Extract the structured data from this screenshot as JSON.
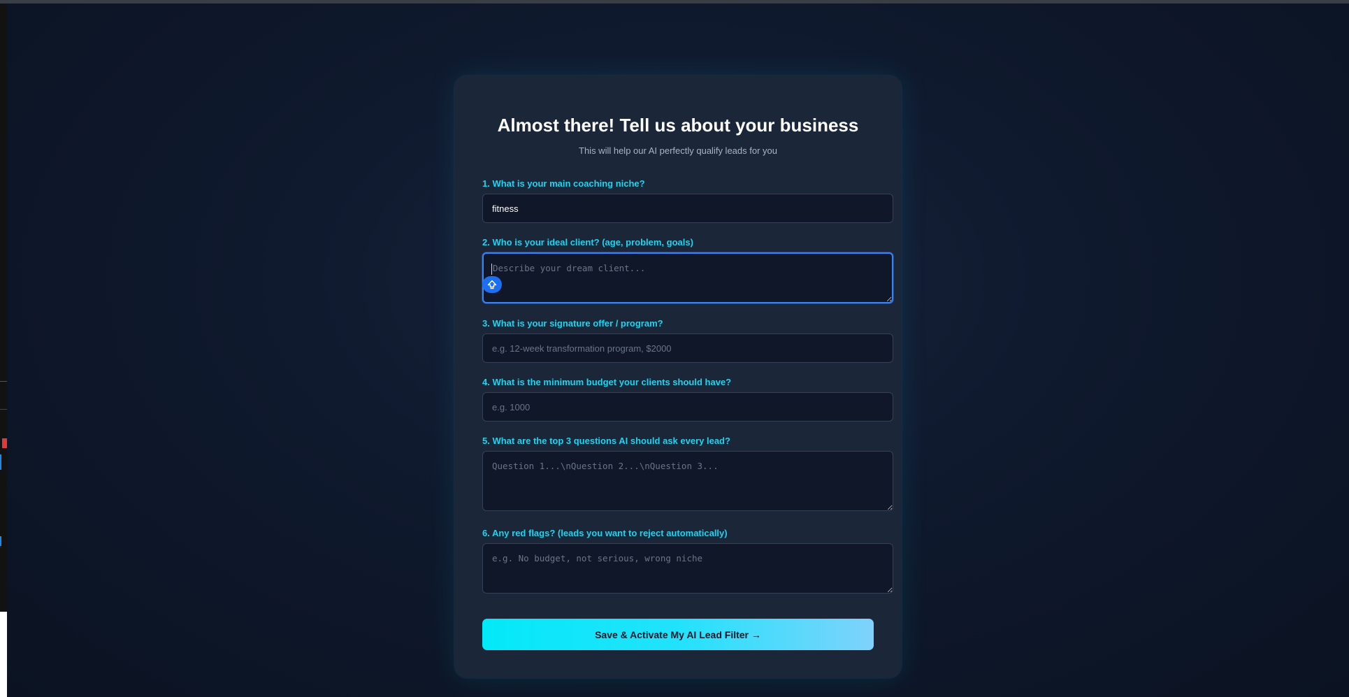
{
  "header": {
    "title": "Almost there! Tell us about your business",
    "subtitle": "This will help our AI perfectly qualify leads for you"
  },
  "form": {
    "q1": {
      "label": "1. What is your main coaching niche?",
      "value": "fitness",
      "placeholder": ""
    },
    "q2": {
      "label": "2. Who is your ideal client? (age, problem, goals)",
      "value": "",
      "placeholder": "Describe your dream client..."
    },
    "q3": {
      "label": "3. What is your signature offer / program?",
      "value": "",
      "placeholder": "e.g. 12-week transformation program, $2000"
    },
    "q4": {
      "label": "4. What is the minimum budget your clients should have?",
      "value": "",
      "placeholder": "e.g. 1000"
    },
    "q5": {
      "label": "5. What are the top 3 questions AI should ask every lead?",
      "value": "",
      "placeholder": "Question 1...\\nQuestion 2...\\nQuestion 3..."
    },
    "q6": {
      "label": "6. Any red flags? (leads you want to reject automatically)",
      "value": "",
      "placeholder": "e.g. No budget, not serious, wrong niche"
    },
    "submit_label": "Save & Activate My AI Lead Filter →"
  },
  "colors": {
    "accent": "#22d3ee",
    "focus": "#3b82f6",
    "card": "#1b2639",
    "input_bg": "#0f1729"
  },
  "icons": {
    "assist_badge": "shift-up-arrow-icon"
  }
}
